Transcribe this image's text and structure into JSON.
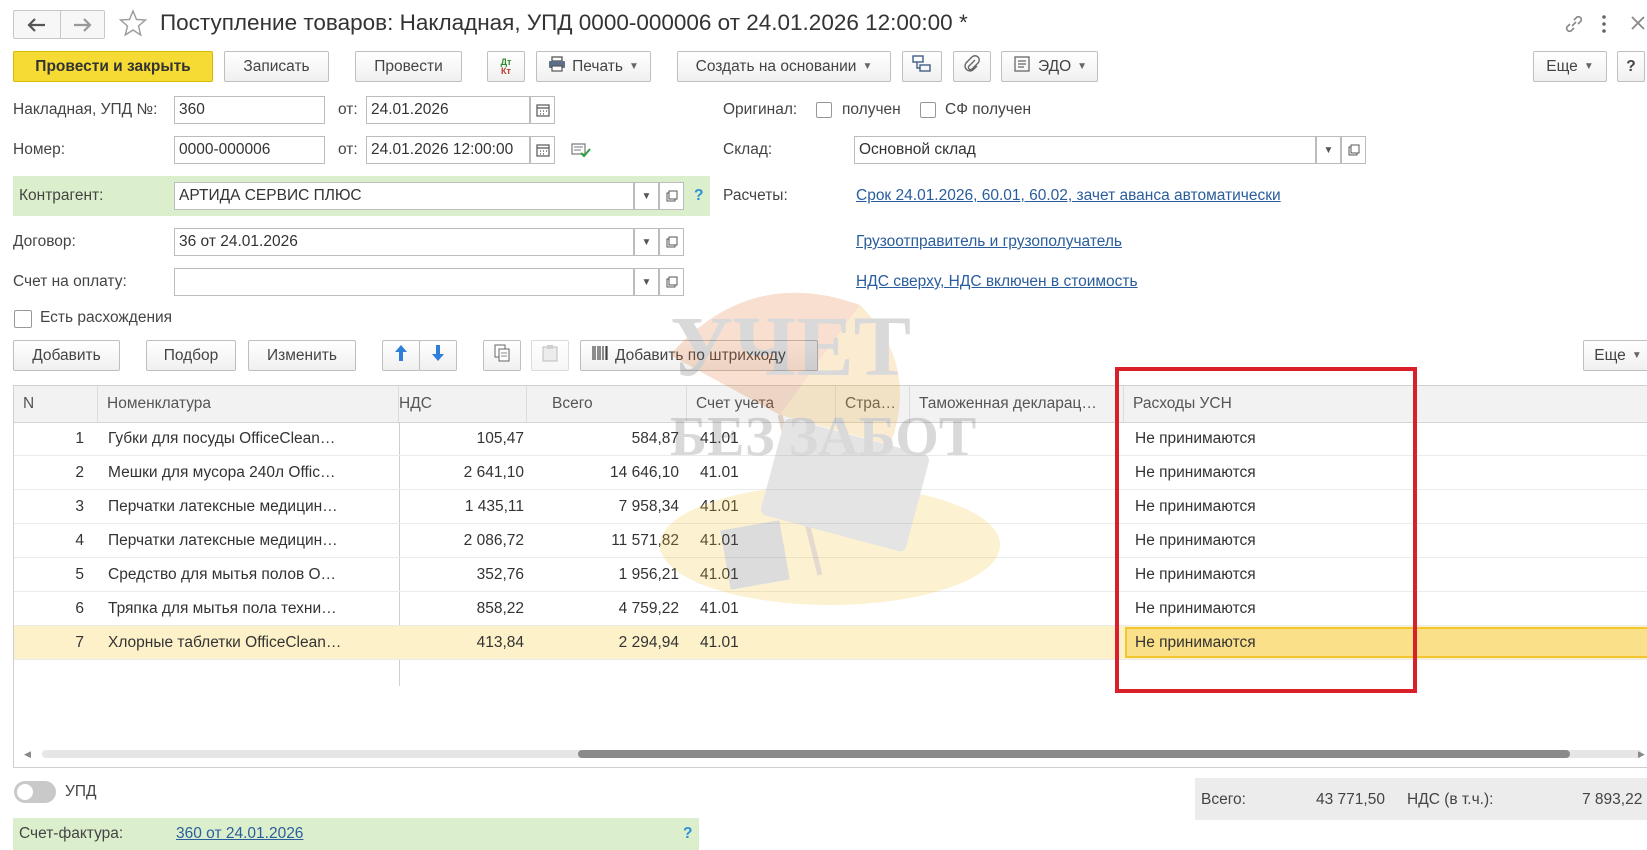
{
  "window": {
    "title": "Поступление товаров: Накладная, УПД 0000-000006 от 24.01.2026 12:00:00 *"
  },
  "toolbar": {
    "post_close": "Провести и закрыть",
    "save": "Записать",
    "post": "Провести",
    "dtkt_top": "Дт",
    "dtkt_bottom": "Кт",
    "print": "Печать",
    "create_based": "Создать на основании",
    "edo": "ЭДО",
    "more": "Еще",
    "help": "?"
  },
  "form": {
    "invoice_label": "Накладная, УПД №:",
    "invoice_no": "360",
    "from_label": "от:",
    "invoice_date": "24.01.2026",
    "number_label": "Номер:",
    "number": "0000-000006",
    "number_datetime": "24.01.2026 12:00:00",
    "original_label": "Оригинал:",
    "received_label": "получен",
    "sf_received_label": "СФ получен",
    "warehouse_label": "Склад:",
    "warehouse": "Основной склад",
    "counterparty_label": "Контрагент:",
    "counterparty": "АРТИДА СЕРВИС ПЛЮС",
    "payments_label": "Расчеты:",
    "payments_link": "Срок 24.01.2026, 60.01, 60.02, зачет аванса автоматически",
    "contract_label": "Договор:",
    "contract": "36 от 24.01.2026",
    "shipper_link": "Грузоотправитель и грузополучатель",
    "payment_invoice_label": "Счет на оплату:",
    "payment_invoice": "",
    "vat_link": "НДС сверху, НДС включен в стоимость",
    "discrepancy_label": "Есть расхождения",
    "help": "?"
  },
  "table_toolbar": {
    "add": "Добавить",
    "pick": "Подбор",
    "edit": "Изменить",
    "barcode": "Добавить по штрихкоду",
    "more": "Еще"
  },
  "table": {
    "headers": {
      "n": "N",
      "item": "Номенклатура",
      "vat": "НДС",
      "total": "Всего",
      "account": "Счет учета",
      "country": "Стра…",
      "customs": "Таможенная декларац…",
      "usn": "Расходы УСН"
    },
    "rows": [
      {
        "n": "1",
        "item": "Губки для посуды OfficeClean…",
        "vat": "105,47",
        "total": "584,87",
        "account": "41.01",
        "usn": "Не принимаются"
      },
      {
        "n": "2",
        "item": "Мешки для мусора 240л Offic…",
        "vat": "2 641,10",
        "total": "14 646,10",
        "account": "41.01",
        "usn": "Не принимаются"
      },
      {
        "n": "3",
        "item": "Перчатки латексные медицин…",
        "vat": "1 435,11",
        "total": "7 958,34",
        "account": "41.01",
        "usn": "Не принимаются"
      },
      {
        "n": "4",
        "item": "Перчатки латексные медицин…",
        "vat": "2 086,72",
        "total": "11 571,82",
        "account": "41.01",
        "usn": "Не принимаются"
      },
      {
        "n": "5",
        "item": "Средство для мытья полов О…",
        "vat": "352,76",
        "total": "1 956,21",
        "account": "41.01",
        "usn": "Не принимаются"
      },
      {
        "n": "6",
        "item": "Тряпка для мытья пола техни…",
        "vat": "858,22",
        "total": "4 759,22",
        "account": "41.01",
        "usn": "Не принимаются"
      },
      {
        "n": "7",
        "item": "Хлорные таблетки OfficeClean…",
        "vat": "413,84",
        "total": "2 294,94",
        "account": "41.01",
        "usn": "Не принимаются"
      }
    ]
  },
  "footer": {
    "upd_label": "УПД",
    "total_label": "Всего:",
    "total": "43 771,50",
    "vat_label": "НДС (в т.ч.):",
    "vat": "7 893,22",
    "invoice_label": "Счет-фактура:",
    "invoice_link": "360 от 24.01.2026",
    "help": "?"
  },
  "watermark": {
    "line1": "УЧЕТ",
    "line2": "БЕЗ ЗАБОТ"
  },
  "colors": {
    "primary_button": "#f6db34",
    "highlight_frame": "#d9202a",
    "link": "#2a5d9c",
    "green_panel": "#dcefcc",
    "selected_row": "#fdf1c9"
  }
}
